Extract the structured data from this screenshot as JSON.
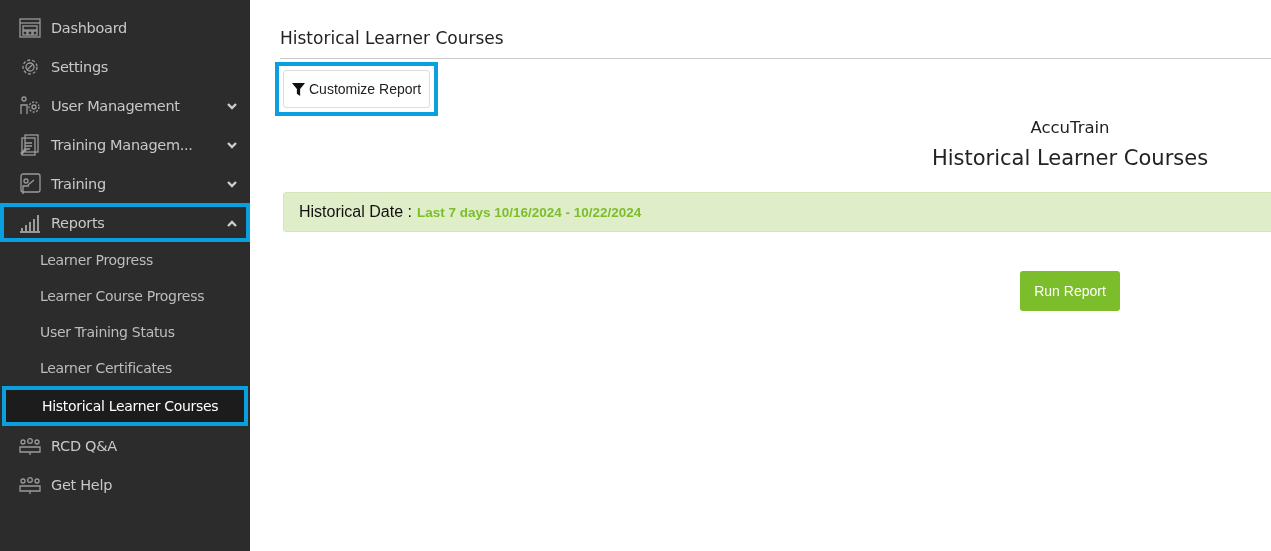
{
  "sidebar": {
    "items": [
      {
        "label": "Dashboard",
        "selected": false,
        "highlighted": false
      },
      {
        "label": "Settings",
        "selected": false,
        "highlighted": false
      },
      {
        "label": "User Management",
        "selected": false,
        "highlighted": false,
        "expanded": false
      },
      {
        "label": "Training Managem...",
        "selected": false,
        "highlighted": false,
        "expanded": false
      },
      {
        "label": "Training",
        "selected": false,
        "highlighted": false,
        "expanded": false
      },
      {
        "label": "Reports",
        "selected": false,
        "highlighted": true,
        "expanded": true,
        "children": [
          {
            "label": "Learner Progress",
            "selected": false,
            "highlighted": false
          },
          {
            "label": "Learner Course Progress",
            "selected": false,
            "highlighted": false
          },
          {
            "label": "User Training Status",
            "selected": false,
            "highlighted": false
          },
          {
            "label": "Learner Certificates",
            "selected": false,
            "highlighted": false
          },
          {
            "label": "Historical Learner Courses",
            "selected": true,
            "highlighted": true
          }
        ]
      },
      {
        "label": "RCD Q&A",
        "selected": false,
        "highlighted": false
      },
      {
        "label": "Get Help",
        "selected": false,
        "highlighted": false
      }
    ]
  },
  "page": {
    "title": "Historical Learner Courses",
    "customize_button": {
      "label": "Customize Report",
      "highlighted": true
    },
    "report_brand": "AccuTrain",
    "report_title": "Historical Learner Courses",
    "date_bar": {
      "label": "Historical Date :",
      "value": "Last 7 days 10/16/2024 - 10/22/2024"
    },
    "run_button": "Run Report"
  }
}
